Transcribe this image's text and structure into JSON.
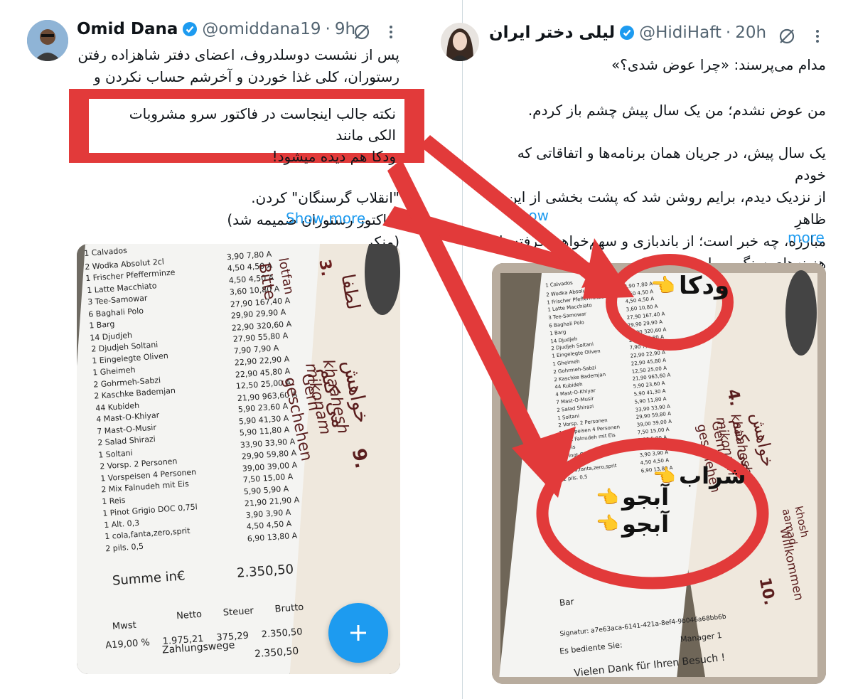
{
  "left_tweet": {
    "name": "Omid Dana",
    "handle": "@omiddana19",
    "time": "9h",
    "text": "پس از نشست دوسلدروف، اعضای دفتر شاهزاده رفتن\nرستوران، کلی غذا خوردن و آخرشم حساب نکردن و فرار",
    "text_cont": "\"انقلاب گرسنگان\" کردن.\n(فاکتور رستوران ضمیمه شد)\n(منکر",
    "show_more": "Show more",
    "highlight": "نکته جالب اینجاست در فاکتور سرو مشروبات الکی مانند\nودکا هم دیده میشود!",
    "receipt": [
      {
        "qty": "1",
        "item": "Calvados",
        "price": "",
        "total": ""
      },
      {
        "qty": "2",
        "item": "Wodka Absolut 2cl",
        "price": "3,90",
        "total": "7,80 A"
      },
      {
        "qty": "1",
        "item": "Frischer Pfefferminze",
        "price": "4,50",
        "total": "4,50 A"
      },
      {
        "qty": "1",
        "item": "Latte Macchiato",
        "price": "4,50",
        "total": "4,50 A"
      },
      {
        "qty": "3",
        "item": "Tee-Samowar",
        "price": "3,60",
        "total": "10,80 A"
      },
      {
        "qty": "6",
        "item": "Baghali Polo",
        "price": "27,90",
        "total": "167,40 A"
      },
      {
        "qty": "1",
        "item": "Barg",
        "price": "29,90",
        "total": "29,90 A"
      },
      {
        "qty": "14",
        "item": "Djudjeh",
        "price": "22,90",
        "total": "320,60 A"
      },
      {
        "qty": "2",
        "item": "Djudjeh Soltani",
        "price": "27,90",
        "total": "55,80 A"
      },
      {
        "qty": "1",
        "item": "Eingelegte Oliven",
        "price": "7,90",
        "total": "7,90 A"
      },
      {
        "qty": "1",
        "item": "Gheimeh",
        "price": "22,90",
        "total": "22,90 A"
      },
      {
        "qty": "2",
        "item": "Gohrmeh-Sabzi",
        "price": "22,90",
        "total": "45,80 A"
      },
      {
        "qty": "2",
        "item": "Kaschke Bademjan",
        "price": "12,50",
        "total": "25,00 A"
      },
      {
        "qty": "44",
        "item": "Kubideh",
        "price": "21,90",
        "total": "963,60 A"
      },
      {
        "qty": "4",
        "item": "Mast-O-Khiyar",
        "price": "5,90",
        "total": "23,60 A"
      },
      {
        "qty": "7",
        "item": "Mast-O-Musir",
        "price": "5,90",
        "total": "41,30 A"
      },
      {
        "qty": "2",
        "item": "Salad Shirazi",
        "price": "5,90",
        "total": "11,80 A"
      },
      {
        "qty": "1",
        "item": "Soltani",
        "price": "33,90",
        "total": "33,90 A"
      },
      {
        "qty": "2",
        "item": "Vorsp. 2 Personen",
        "price": "29,90",
        "total": "59,80 A"
      },
      {
        "qty": "1",
        "item": "Vorspeisen 4 Personen",
        "price": "39,00",
        "total": "39,00 A"
      },
      {
        "qty": "2",
        "item": "Mix Falnudeh mit Eis",
        "price": "7,50",
        "total": "15,00 A"
      },
      {
        "qty": "1",
        "item": "Reis",
        "price": "5,90",
        "total": "5,90 A"
      },
      {
        "qty": "1",
        "item": "Pinot Grigio DOC 0,75l",
        "price": "21,90",
        "total": "21,90 A"
      },
      {
        "qty": "1",
        "item": "Alt. 0,3",
        "price": "3,90",
        "total": "3,90 A"
      },
      {
        "qty": "1",
        "item": "cola,fanta,zero,sprit",
        "price": "4,50",
        "total": "4,50 A"
      },
      {
        "qty": "2",
        "item": "pils. 0,5",
        "price": "6,90",
        "total": "13,80 A"
      }
    ],
    "receipt_total_label": "Summe in€",
    "receipt_total": "2.350,50",
    "receipt_tax_headers": [
      "Netto",
      "Steuer",
      "Brutto"
    ],
    "receipt_mwst": "Mwst",
    "receipt_tax_row": [
      "A19,00 %",
      "1.975,21",
      "375,29",
      "2.350,50"
    ],
    "receipt_payment": "Zahlungswege",
    "receipt_payment_total": "2.350,50",
    "menu_texts": [
      "3.",
      "لطفا",
      "lotfan",
      "Bitte",
      "خواهش می کنم",
      "khaahesh mikonam",
      "Gern geschehen",
      "9."
    ]
  },
  "right_tweet": {
    "name": "لیلی دختر ایران",
    "handle": "@HidiHaft",
    "time": "20h",
    "text1": "مدام می‌پرسند: «چرا عوض شدی؟»",
    "text2": "من عوض نشدم؛ من یک سال پیش چشم باز کردم.",
    "text3": "یک سال پیش، در جریان همان برنامه‌ها و اتفاقاتی که خودم\nاز نزدیک دیدم، برایم روشن شد که پشت بخشی از این ظاهرِ\nمبارزه، چه خبر است؛ از باندبازی و سهم‌خواهی گرفته تا\nهزینه‌های سنگین برای هتل و تاکسی و سخنران و",
    "show_more_1": "Show",
    "show_more_2": "more",
    "annotation_vodka": "ودکا",
    "annotation_wine": "شراب",
    "annotation_beer1": "آبجو",
    "annotation_beer2": "آبجو",
    "menu_texts": [
      "4.",
      "خواهش می کنم",
      "khaahesh mikonam",
      "Gern geschehen",
      "10.",
      "khosh aamad",
      "Willkommen"
    ],
    "receipt_extra": [
      "Bar",
      "Signatur: a7e63aca-6141-421a-8ef4-9b046a68bb6b",
      "Es bediente Sie:",
      "Manager 1",
      "Vielen Dank für Ihren Besuch !"
    ]
  },
  "colors": {
    "accent": "#1d9bf0",
    "annotation_red": "#e23a3a",
    "verified": "#1d9bf0"
  }
}
